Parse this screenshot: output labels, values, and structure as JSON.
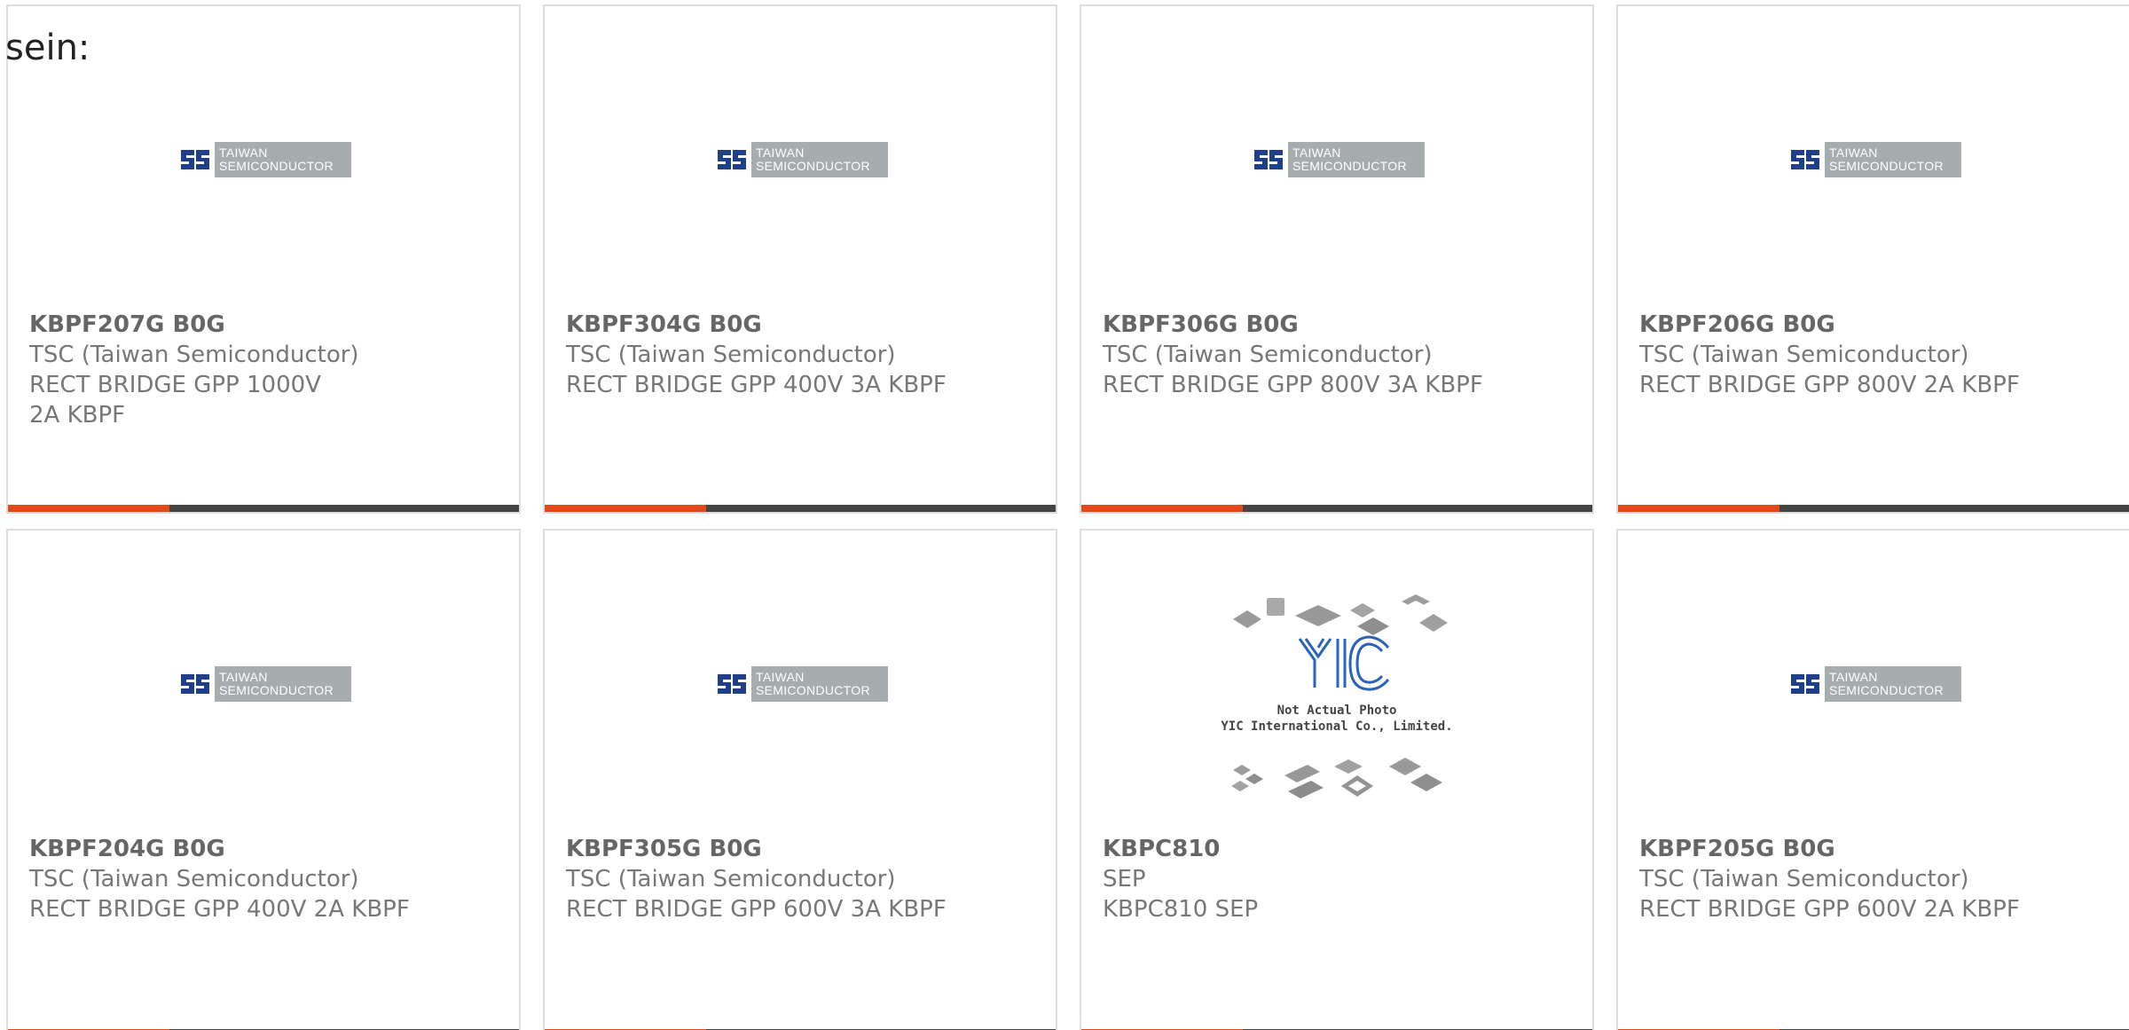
{
  "lead_text": "sein:",
  "logo": {
    "tsc_line1": "TAIWAN",
    "tsc_line2": "SEMICONDUCTOR",
    "yic_caption_line1": "Not Actual Photo",
    "yic_caption_line2": "YIC International Co., Limited."
  },
  "colors": {
    "accent_bar": "#e24a1a",
    "bar": "#444444",
    "card_border": "#dddddd"
  },
  "products": [
    {
      "part": "KBPF207G B0G",
      "manufacturer": "TSC (Taiwan Semiconductor)",
      "description": "RECT BRIDGE GPP 1000V 2A KBPF",
      "image": "tsc-logo"
    },
    {
      "part": "KBPF304G B0G",
      "manufacturer": "TSC (Taiwan Semiconductor)",
      "description": "RECT BRIDGE GPP 400V 3A KBPF",
      "image": "tsc-logo"
    },
    {
      "part": "KBPF306G B0G",
      "manufacturer": "TSC (Taiwan Semiconductor)",
      "description": "RECT BRIDGE GPP 800V 3A KBPF",
      "image": "tsc-logo"
    },
    {
      "part": "KBPF206G B0G",
      "manufacturer": "TSC (Taiwan Semiconductor)",
      "description": "RECT BRIDGE GPP 800V 2A KBPF",
      "image": "tsc-logo"
    },
    {
      "part": "KBPF204G B0G",
      "manufacturer": "TSC (Taiwan Semiconductor)",
      "description": "RECT BRIDGE GPP 400V 2A KBPF",
      "image": "tsc-logo"
    },
    {
      "part": "KBPF305G B0G",
      "manufacturer": "TSC (Taiwan Semiconductor)",
      "description": "RECT BRIDGE GPP 600V 3A KBPF",
      "image": "tsc-logo"
    },
    {
      "part": "KBPC810",
      "manufacturer": "SEP",
      "description": "KBPC810 SEP",
      "image": "yic-placeholder"
    },
    {
      "part": "KBPF205G B0G",
      "manufacturer": "TSC (Taiwan Semiconductor)",
      "description": "RECT BRIDGE GPP 600V 2A KBPF",
      "image": "tsc-logo"
    }
  ]
}
